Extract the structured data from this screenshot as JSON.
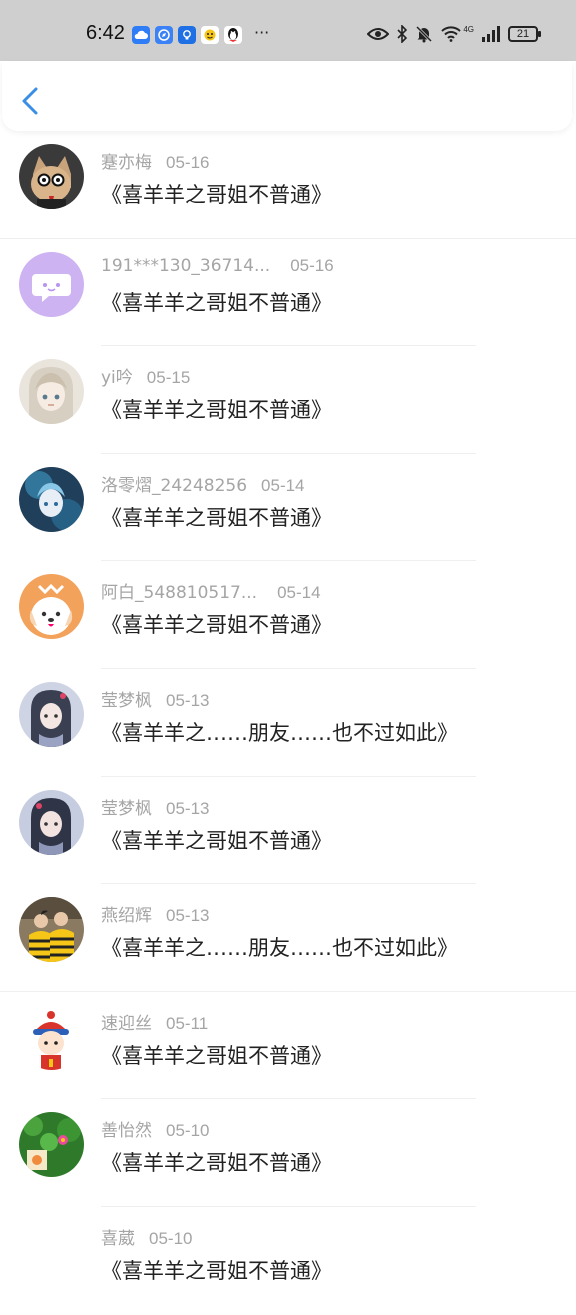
{
  "status_bar": {
    "time": "6:42",
    "battery": "21",
    "network": "4G",
    "more": "···"
  },
  "comments": [
    {
      "user": "蹇亦梅",
      "date": "05-16",
      "text": "《喜羊羊之哥姐不普通》",
      "avatar": "cat-avatar"
    },
    {
      "user": "191***130_36714...",
      "date": "05-16",
      "text": "《喜羊羊之哥姐不普通》",
      "avatar": "default-chat-avatar"
    },
    {
      "user": "yi吟",
      "date": "05-15",
      "text": "《喜羊羊之哥姐不普通》",
      "avatar": "anime-girl-avatar"
    },
    {
      "user": "洛零熠_24248256",
      "date": "05-14",
      "text": "《喜羊羊之哥姐不普通》",
      "avatar": "anime-blue-avatar"
    },
    {
      "user": "阿白_548810517...",
      "date": "05-14",
      "text": "《喜羊羊之哥姐不普通》",
      "avatar": "dog-avatar"
    },
    {
      "user": "莹梦枫",
      "date": "05-13",
      "text": "《喜羊羊之……朋友……也不过如此》",
      "avatar": "anime-girl-avatar"
    },
    {
      "user": "莹梦枫",
      "date": "05-13",
      "text": "《喜羊羊之哥姐不普通》",
      "avatar": "anime-girl-avatar"
    },
    {
      "user": "燕绍辉",
      "date": "05-13",
      "text": "《喜羊羊之……朋友……也不过如此》",
      "avatar": "couple-photo-avatar"
    },
    {
      "user": "速迎丝",
      "date": "05-11",
      "text": "《喜羊羊之哥姐不普通》",
      "avatar": "cartoon-character-avatar"
    },
    {
      "user": "善怡然",
      "date": "05-10",
      "text": "《喜羊羊之哥姐不普通》",
      "avatar": "plant-avatar"
    },
    {
      "user": "喜葳",
      "date": "05-10",
      "text": "《喜羊羊之哥姐不普通》",
      "avatar": "blank-avatar"
    }
  ]
}
